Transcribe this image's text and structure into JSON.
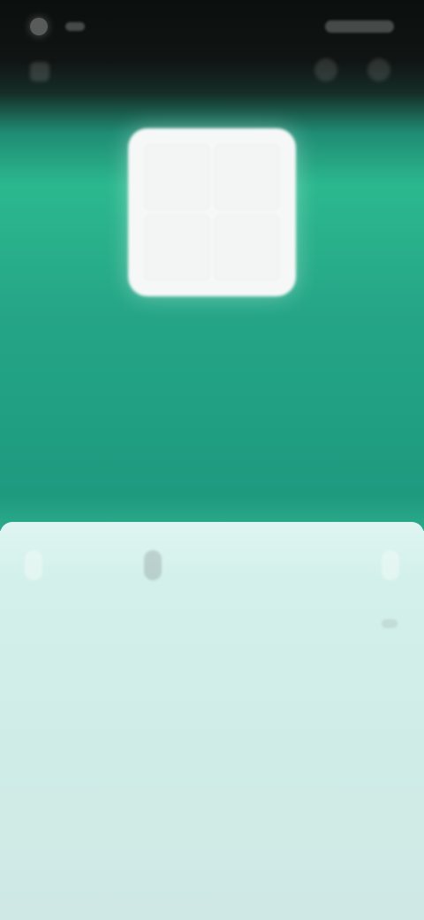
{
  "status_bar": {
    "time": "",
    "right": ""
  },
  "tabs": [
    {
      "label": ""
    },
    {
      "label": ""
    },
    {
      "label": ""
    },
    {
      "label": ""
    }
  ],
  "sheet": {
    "subtext": ""
  },
  "colors": {
    "hero_green": "#2bb88f",
    "sheet_bg": "#d3f0ea",
    "tile": "#f6f8f7"
  }
}
